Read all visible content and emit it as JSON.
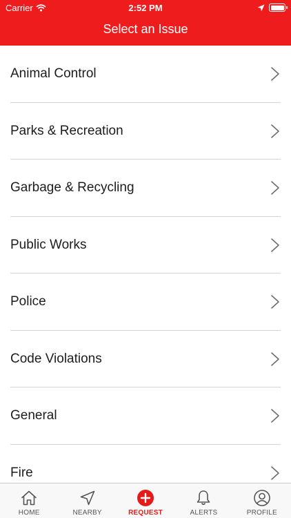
{
  "status_bar": {
    "carrier": "Carrier",
    "time": "2:52 PM",
    "battery_level": 1.0
  },
  "nav": {
    "title": "Select an Issue"
  },
  "issues": [
    {
      "label": "Animal Control"
    },
    {
      "label": "Parks & Recreation"
    },
    {
      "label": "Garbage & Recycling"
    },
    {
      "label": "Public Works"
    },
    {
      "label": "Police"
    },
    {
      "label": "Code Violations"
    },
    {
      "label": "General"
    },
    {
      "label": "Fire"
    }
  ],
  "tabs": [
    {
      "label": "HOME",
      "icon": "home-icon"
    },
    {
      "label": "NEARBY",
      "icon": "location-arrow-icon"
    },
    {
      "label": "REQUEST",
      "icon": "plus-circle-icon",
      "active": true
    },
    {
      "label": "ALERTS",
      "icon": "bell-icon"
    },
    {
      "label": "PROFILE",
      "icon": "user-icon"
    }
  ],
  "colors": {
    "brand_red": "#ee1c1c",
    "active_tab": "#e31b1b",
    "inactive_tab": "#555555",
    "separator": "#d4d4d4"
  }
}
